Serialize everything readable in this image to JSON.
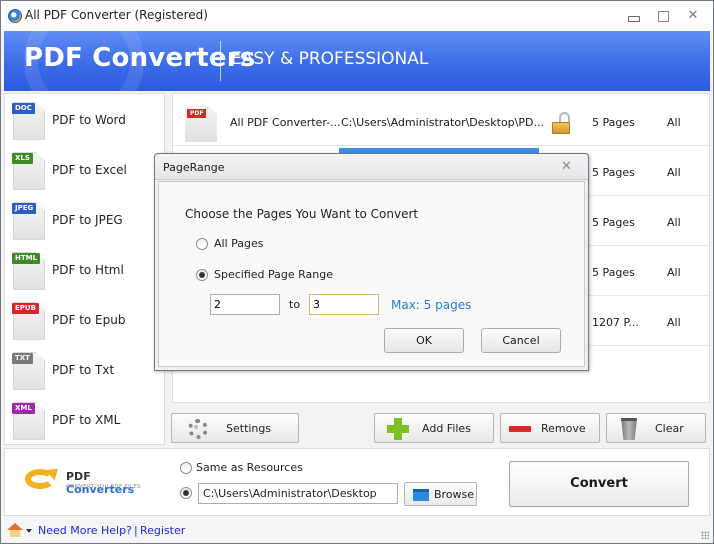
{
  "window": {
    "title": "All PDF Converter (Registered)",
    "close_glyph": "✕"
  },
  "banner": {
    "title": "PDF Converters",
    "tagline": "EASY & PROFESSIONAL"
  },
  "sidebar": {
    "items": [
      {
        "label": "PDF to Word",
        "badge": "DOC",
        "badge_color": "#2a5fbf"
      },
      {
        "label": "PDF to Excel",
        "badge": "XLS",
        "badge_color": "#3d8a2a"
      },
      {
        "label": "PDF to JPEG",
        "badge": "JPEG",
        "badge_color": "#2a5fbf"
      },
      {
        "label": "PDF to Html",
        "badge": "HTML",
        "badge_color": "#3d8a2a"
      },
      {
        "label": "PDF to Epub",
        "badge": "EPUB",
        "badge_color": "#d8262a"
      },
      {
        "label": "PDF to Txt",
        "badge": "TXT",
        "badge_color": "#7a7a7a"
      },
      {
        "label": "PDF to XML",
        "badge": "XML",
        "badge_color": "#9a2aa8"
      }
    ]
  },
  "file_list": {
    "badge": "PDF",
    "rows": [
      {
        "name": "All PDF Converter-...",
        "path": "C:\\Users\\Administrator\\Desktop\\PD...",
        "pages": "5 Pages",
        "range": "All",
        "locked": false
      },
      {
        "name": "",
        "path": "",
        "pages": "5 Pages",
        "range": "All"
      },
      {
        "name": "",
        "path": "",
        "pages": "5 Pages",
        "range": "All"
      },
      {
        "name": "",
        "path": "",
        "pages": "5 Pages",
        "range": "All"
      },
      {
        "name": "",
        "path": "",
        "pages": "1207 P...",
        "range": "All"
      }
    ],
    "progress_percent": 100
  },
  "toolbar": {
    "settings": "Settings",
    "add_files": "Add Files",
    "remove": "Remove",
    "clear": "Clear"
  },
  "output": {
    "logo_pdf": "PDF",
    "logo_converters": "Converters",
    "logo_sub": "Convert You PDF files",
    "same_as_resources": "Same as Resources",
    "path_value": "C:\\Users\\Administrator\\Desktop",
    "browse": "Browse",
    "convert": "Convert",
    "selected_option": "custom-path"
  },
  "statusbar": {
    "help_link": "Need More Help?",
    "separator": "|",
    "register_link": "Register"
  },
  "dialog": {
    "title": "PageRange",
    "close_glyph": "✕",
    "heading": "Choose the Pages You Want to Convert",
    "option_all": "All Pages",
    "option_range": "Specified Page Range",
    "selected_option": "range",
    "from_value": "2",
    "to_label": "to",
    "to_value": "3",
    "max_label": "Max: 5 pages",
    "ok": "OK",
    "cancel": "Cancel"
  }
}
